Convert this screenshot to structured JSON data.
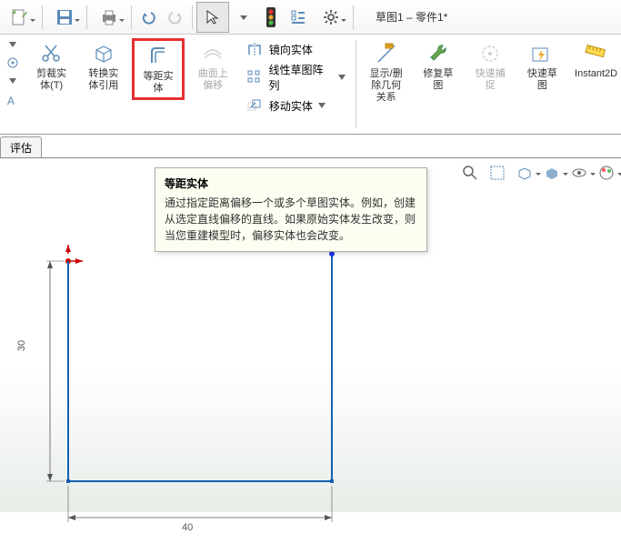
{
  "title": "草图1 – 零件1*",
  "ribbon": {
    "trim": "剪裁实体(T)",
    "convert": "转换实体引用",
    "offset": "等距实体",
    "surface_offset": "曲面上偏移",
    "mirror": "镜向实体",
    "pattern": "线性草图阵列",
    "move": "移动实体",
    "display_rel": "显示/删除几何关系",
    "repair": "修复草图",
    "quick_snap": "快速捕捉",
    "rapid_sketch": "快速草图",
    "instant2d": "Instant2D"
  },
  "tab": "评估",
  "tooltip": {
    "title": "等距实体",
    "body": "通过指定距离偏移一个或多个草图实体。例如，创建从选定直线偏移的直线。如果原始实体发生改变，则当您重建模型时，偏移实体也会改变。"
  },
  "dims": {
    "v": "30",
    "h": "40"
  }
}
